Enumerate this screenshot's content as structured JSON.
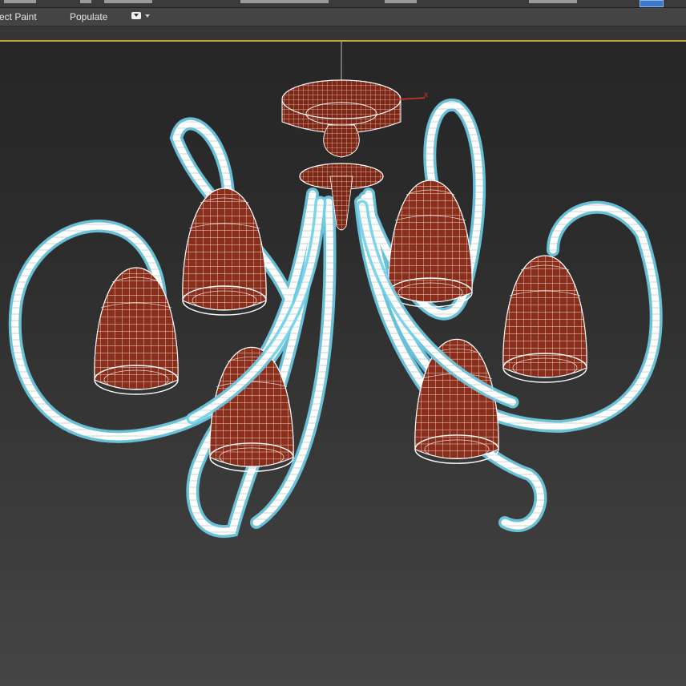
{
  "ribbon": {
    "object_paint_label": "ect Paint",
    "populate_label": "Populate"
  },
  "viewport": {
    "model": "chandelier-wireframe",
    "wire_color": "#ffffff",
    "selection_glow_color": "#6fd0ea",
    "shade_fill_color": "#8a2e1c",
    "gizmo_axis_label": "x"
  },
  "icons": [
    "dropdown-icon",
    "maximize-toggle-icon"
  ]
}
